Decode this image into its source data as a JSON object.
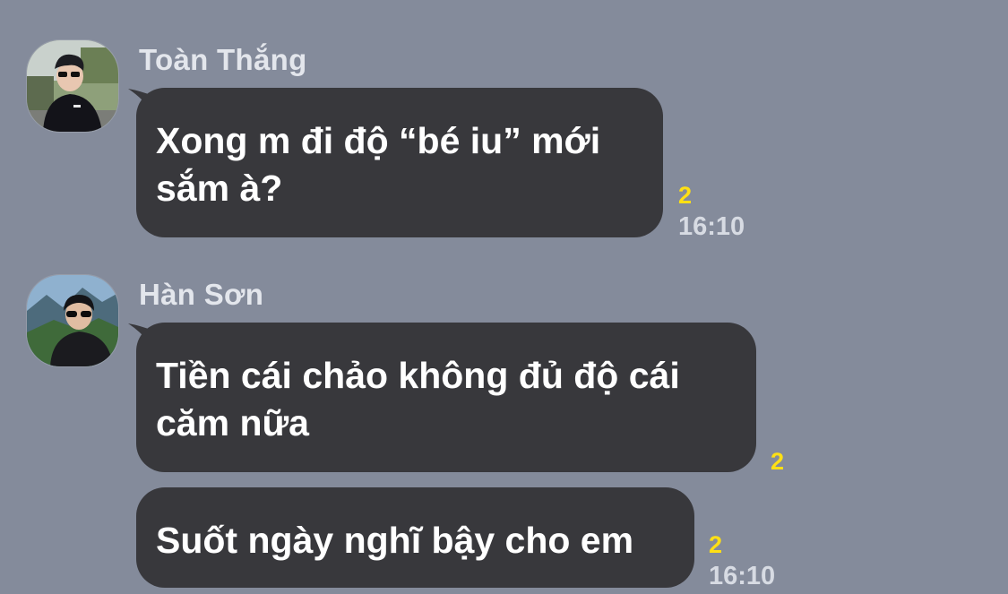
{
  "colors": {
    "background": "#848b9b",
    "bubble": "#38383c",
    "read_count": "#ffe014",
    "sender_name": "#e3e6ec",
    "time": "#d7dbe3"
  },
  "messages": [
    {
      "sender": "Toàn Thắng",
      "avatar_icon": "profile-photo-icon",
      "text": "Xong m đi độ “bé iu” mới sắm à?",
      "read_count": "2",
      "time": "16:10"
    },
    {
      "sender": "Hàn Sơn",
      "avatar_icon": "profile-photo-icon",
      "text": "Tiền cái chảo không đủ độ cái căm nữa",
      "read_count": "2",
      "time": ""
    },
    {
      "sender": "",
      "text": "Suốt ngày nghĩ bậy cho em",
      "read_count": "2",
      "time": "16:10"
    }
  ]
}
